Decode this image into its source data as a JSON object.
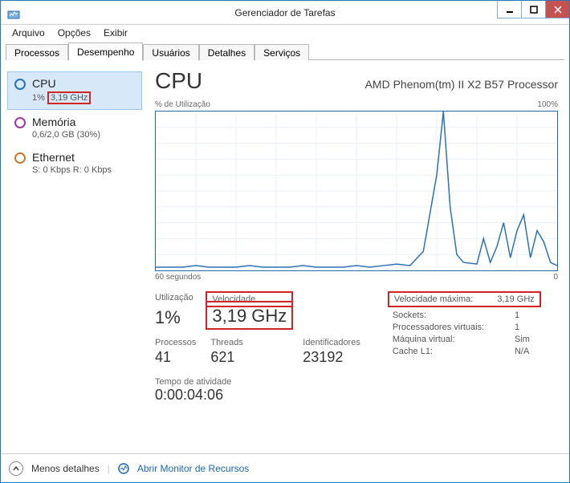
{
  "window": {
    "title": "Gerenciador de Tarefas"
  },
  "menu": {
    "file": "Arquivo",
    "options": "Opções",
    "view": "Exibir"
  },
  "tabs": {
    "processes": "Processos",
    "performance": "Desempenho",
    "users": "Usuários",
    "details": "Detalhes",
    "services": "Serviços"
  },
  "sidebar": {
    "cpu": {
      "title": "CPU",
      "sub_prefix": "1% ",
      "sub_highlight": "3,19 GHz"
    },
    "mem": {
      "title": "Memória",
      "sub": "0,6/2,0 GB (30%)"
    },
    "eth": {
      "title": "Ethernet",
      "sub": "S: 0 Kbps R: 0 Kbps"
    }
  },
  "main": {
    "title": "CPU",
    "cpu_name": "AMD Phenom(tm) II X2 B57 Processor",
    "util_label": "% de Utilização",
    "util_100": "100%",
    "x_left": "60 segundos",
    "x_right": "0",
    "labels": {
      "utilization": "Utilização",
      "speed": "Velocidade",
      "processes": "Processos",
      "threads": "Threads",
      "handles": "Identificadores",
      "uptime": "Tempo de atividade",
      "max_speed": "Velocidade máxima:",
      "sockets": "Sockets:",
      "virtual_processors": "Processadores virtuais:",
      "virtual_machine": "Máquina virtual:",
      "l1cache": "Cache L1:"
    },
    "values": {
      "utilization": "1%",
      "speed": "3,19 GHz",
      "processes": "41",
      "threads": "621",
      "handles": "23192",
      "uptime": "0:00:04:06",
      "max_speed": "3,19 GHz",
      "sockets": "1",
      "virtual_processors": "1",
      "virtual_machine": "Sim",
      "l1cache": "N/A"
    }
  },
  "footer": {
    "less_details": "Menos detalhes",
    "open_resource_monitor": "Abrir Monitor de Recursos"
  },
  "chart_data": {
    "type": "line",
    "title": "% de Utilização",
    "xlabel": "segundos",
    "ylabel": "%",
    "xlim": [
      60,
      0
    ],
    "ylim": [
      0,
      100
    ],
    "series": [
      {
        "name": "CPU",
        "x": [
          60,
          58,
          56,
          54,
          52,
          50,
          48,
          46,
          44,
          42,
          40,
          38,
          36,
          34,
          32,
          30,
          28,
          26,
          24,
          22,
          20,
          18,
          17,
          16,
          15,
          14,
          12,
          11,
          10,
          9,
          8,
          7,
          6,
          5,
          4,
          3,
          2,
          1,
          0
        ],
        "y": [
          2,
          2,
          2,
          3,
          2,
          2,
          2,
          3,
          2,
          2,
          2,
          3,
          2,
          2,
          2,
          3,
          2,
          3,
          4,
          3,
          12,
          60,
          100,
          40,
          10,
          5,
          4,
          20,
          5,
          15,
          30,
          8,
          25,
          35,
          8,
          25,
          18,
          5,
          3
        ]
      }
    ]
  }
}
